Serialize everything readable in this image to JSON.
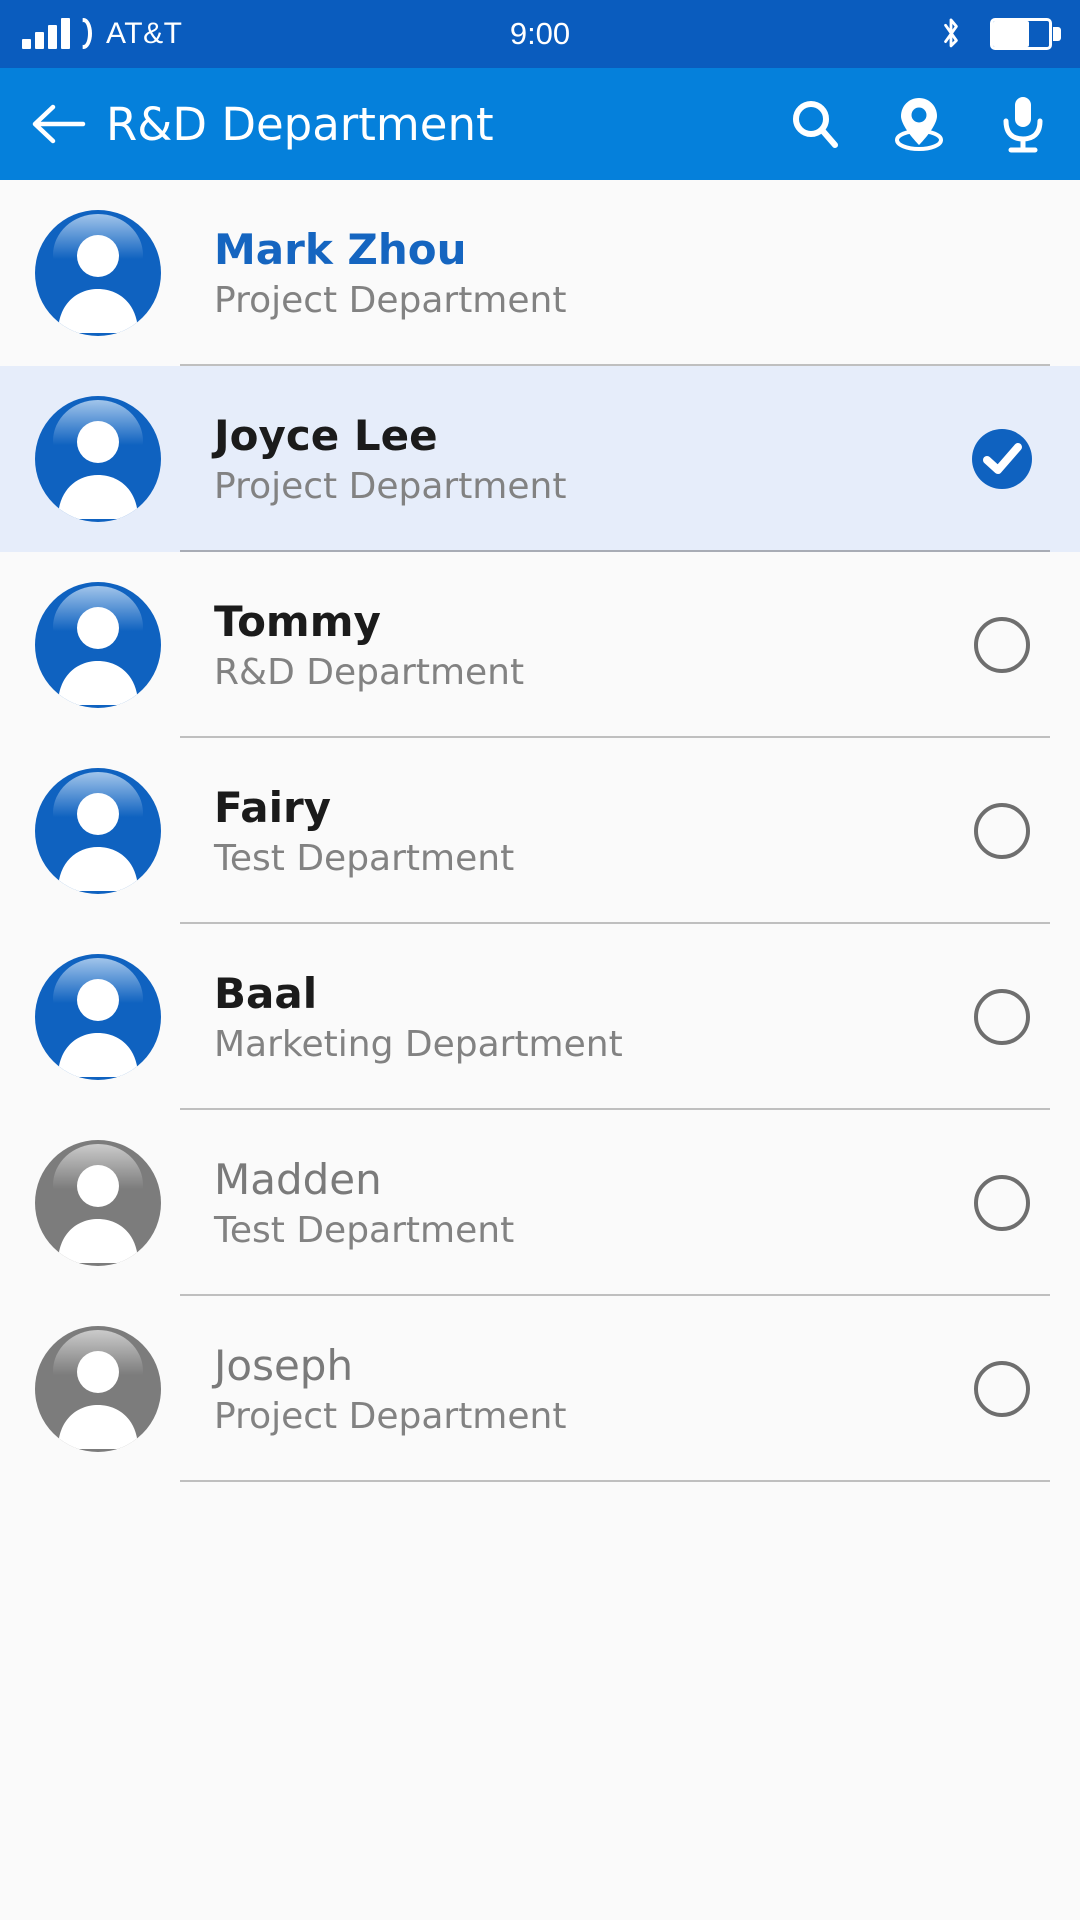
{
  "status_bar": {
    "carrier": "AT&T",
    "time": "9:00",
    "signal_icon": "signal-bars-icon",
    "bluetooth_icon": "bluetooth-icon",
    "battery_icon": "battery-icon",
    "battery_level_percent": 65,
    "background_color": "#0A5CBE"
  },
  "app_bar": {
    "title": "R&D Department",
    "back_icon": "back-arrow-icon",
    "actions": [
      {
        "icon": "search-icon",
        "label": "Search"
      },
      {
        "icon": "location-pin-icon",
        "label": "Location"
      },
      {
        "icon": "microphone-icon",
        "label": "Voice"
      }
    ],
    "background_color": "#0580DB"
  },
  "colors": {
    "accent": "#1565C0",
    "selected_row_background": "#E6EDFA",
    "page_background": "#FAFAFA",
    "avatar_blue": "#0F62C0",
    "avatar_gray": "#7C7C7C",
    "subtitle_gray": "#828282",
    "divider": "#BFBFBF"
  },
  "contact_list": [
    {
      "name": "Mark Zhou",
      "department": "Project Department",
      "avatar_color": "blue",
      "name_style": "accent",
      "selected": false,
      "control": "none"
    },
    {
      "name": "Joyce Lee",
      "department": "Project Department",
      "avatar_color": "blue",
      "name_style": "normal",
      "selected": true,
      "control": "checked"
    },
    {
      "name": "Tommy",
      "department": "R&D Department",
      "avatar_color": "blue",
      "name_style": "normal",
      "selected": false,
      "control": "unchecked"
    },
    {
      "name": "Fairy",
      "department": "Test Department",
      "avatar_color": "blue",
      "name_style": "normal",
      "selected": false,
      "control": "unchecked"
    },
    {
      "name": "Baal",
      "department": "Marketing Department",
      "avatar_color": "blue",
      "name_style": "normal",
      "selected": false,
      "control": "unchecked"
    },
    {
      "name": "Madden",
      "department": "Test Department",
      "avatar_color": "gray",
      "name_style": "muted",
      "selected": false,
      "control": "unchecked"
    },
    {
      "name": "Joseph",
      "department": "Project Department",
      "avatar_color": "gray",
      "name_style": "muted",
      "selected": false,
      "control": "unchecked"
    }
  ]
}
